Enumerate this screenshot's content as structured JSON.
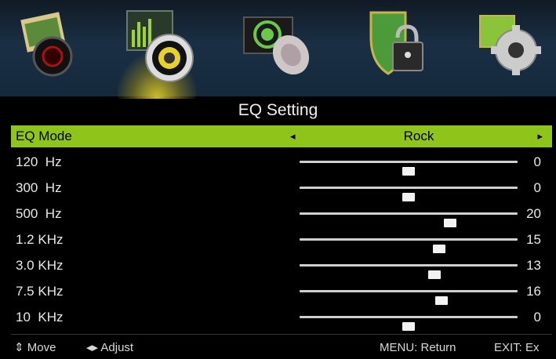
{
  "tabs": [
    {
      "icon": "picture-icon",
      "active": false
    },
    {
      "icon": "sound-icon",
      "active": true
    },
    {
      "icon": "channel-icon",
      "active": false
    },
    {
      "icon": "lock-icon",
      "active": false
    },
    {
      "icon": "setup-icon",
      "active": false
    }
  ],
  "title": "EQ Setting",
  "mode": {
    "label": "EQ Mode",
    "value": "Rock",
    "left_arrow": "◂",
    "right_arrow": "▸"
  },
  "bands": [
    {
      "label": "120  Hz",
      "value": "0",
      "level": 0.5
    },
    {
      "label": "300  Hz",
      "value": "0",
      "level": 0.5
    },
    {
      "label": "500  Hz",
      "value": "20",
      "level": 0.69
    },
    {
      "label": "1.2 KHz",
      "value": "15",
      "level": 0.64
    },
    {
      "label": "3.0 KHz",
      "value": "13",
      "level": 0.62
    },
    {
      "label": "7.5 KHz",
      "value": "16",
      "level": 0.65
    },
    {
      "label": "10  KHz",
      "value": "0",
      "level": 0.5
    }
  ],
  "footer": {
    "move": "⇕ Move",
    "adjust": "◂▸ Adjust",
    "menu": "MENU: Return",
    "exit": "EXIT: Ex"
  },
  "colors": {
    "highlight": "#8fc41a",
    "background": "#000000",
    "header": "#1a2f44"
  }
}
